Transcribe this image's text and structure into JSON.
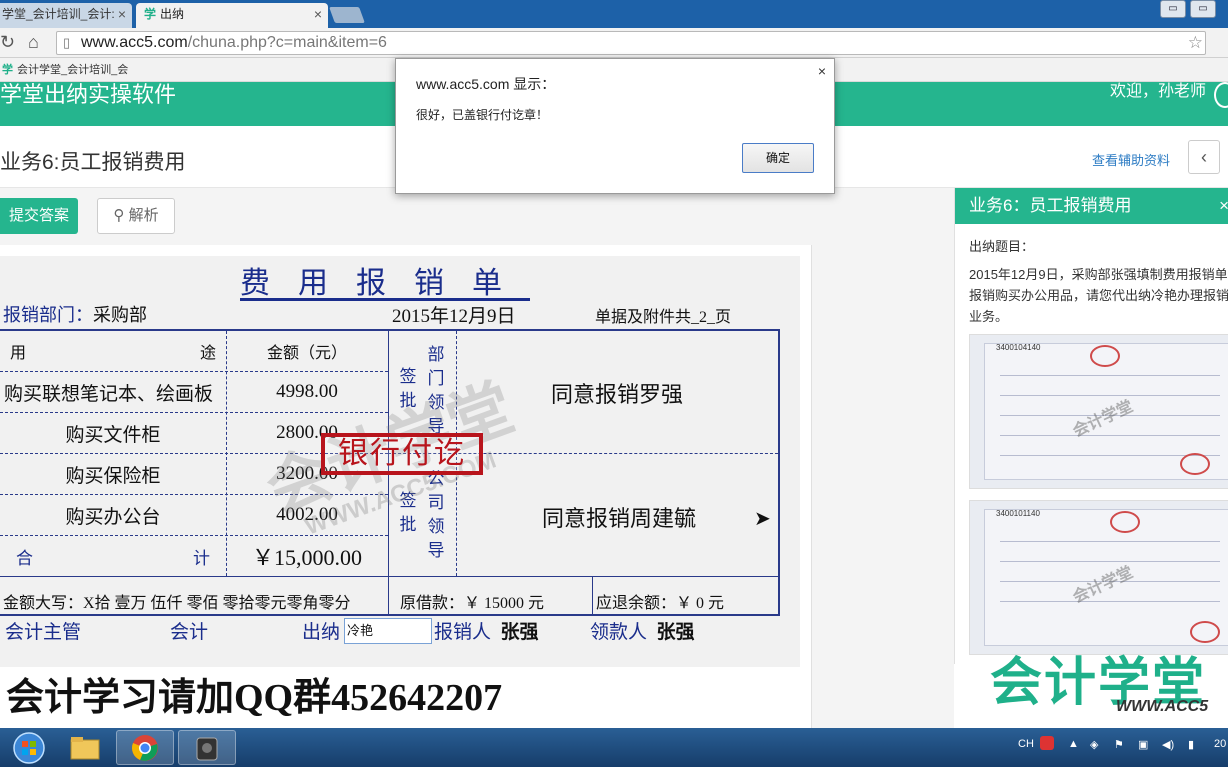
{
  "browser": {
    "tabs": [
      {
        "label": "学堂_会计培训_会计:"
      },
      {
        "label": "出纳",
        "icon_glyph": "学"
      }
    ],
    "url_host": "www.acc5.com",
    "url_path": "/chuna.php?c=main&item=6",
    "bookmark": {
      "icon_glyph": "学",
      "label": "会计学堂_会计培训_会"
    }
  },
  "app": {
    "title": "学堂出纳实操软件",
    "welcome": "欢迎，孙老师",
    "brand_color": "#25b58e"
  },
  "page": {
    "title": "业务6:员工报销费用",
    "help_link": "查看辅助资料",
    "back_glyph": "‹",
    "submit_label": "提交答案",
    "analysis_label": "解析",
    "analysis_icon_glyph": "⚲"
  },
  "form": {
    "title": "费用报销单",
    "dept_label": "报销部门：",
    "dept_value": "采购部",
    "date": "2015年12月9日",
    "attachments": "单据及附件共_2_页",
    "col_purpose": "用 途",
    "col_purpose_left": "用",
    "col_purpose_right": "途",
    "col_amount": "金额（元）",
    "rows": [
      {
        "purpose": "购买联想笔记本、绘画板",
        "amount": "4998.00"
      },
      {
        "purpose": "购买文件柜",
        "amount": "2800.00"
      },
      {
        "purpose": "购买保险柜",
        "amount": "3200.00"
      },
      {
        "purpose": "购买办公台",
        "amount": "4002.00"
      }
    ],
    "total_left": "合",
    "total_right": "计",
    "total_amount": "￥15,000.00",
    "sign1_label": "签批",
    "dept_leader": "部门领导",
    "dept_opinion": "同意报销罗强",
    "sign2_label": "签批",
    "co_leader": "公司领导",
    "co_opinion": "同意报销周建毓",
    "amount_words": "金额大写：X拾 壹万 伍仟 零佰 零拾零元零角零分",
    "advance": "原借款：￥  15000  元",
    "refund": "应退余额：￥  0   元",
    "sig_accounting_head": "会计主管",
    "sig_accountant": "会计",
    "sig_cashier": "出纳",
    "cashier_value": "冷艳",
    "sig_claimant_label": "报销人",
    "sig_claimant": "张强",
    "sig_receiver_label": "领款人",
    "sig_receiver": "张强",
    "stamp_text": "银行付讫",
    "watermark": "会计学堂",
    "watermark_url": "WWW.ACC5.COM"
  },
  "promo": "会计学习请加QQ群452642207",
  "panel": {
    "title": "业务6：员工报销费用",
    "close_glyph": "×",
    "label": "出纳题目：",
    "desc": "2015年12月9日，采购部张强填制费用报销单报销购买办公用品，请您代出纳冷艳办理报销业务。",
    "thumb1_code": "3400104140",
    "thumb2_code": "3400101140",
    "thumb_watermark": "会计学堂",
    "logo": "会计学堂",
    "logo_url": "WWW.ACC5"
  },
  "dialog": {
    "title": "www.acc5.com 显示：",
    "message": "很好，已盖银行付讫章！",
    "ok_label": "确定",
    "close_glyph": "×"
  },
  "taskbar": {
    "tray_lang": "CH",
    "clock": "20"
  }
}
